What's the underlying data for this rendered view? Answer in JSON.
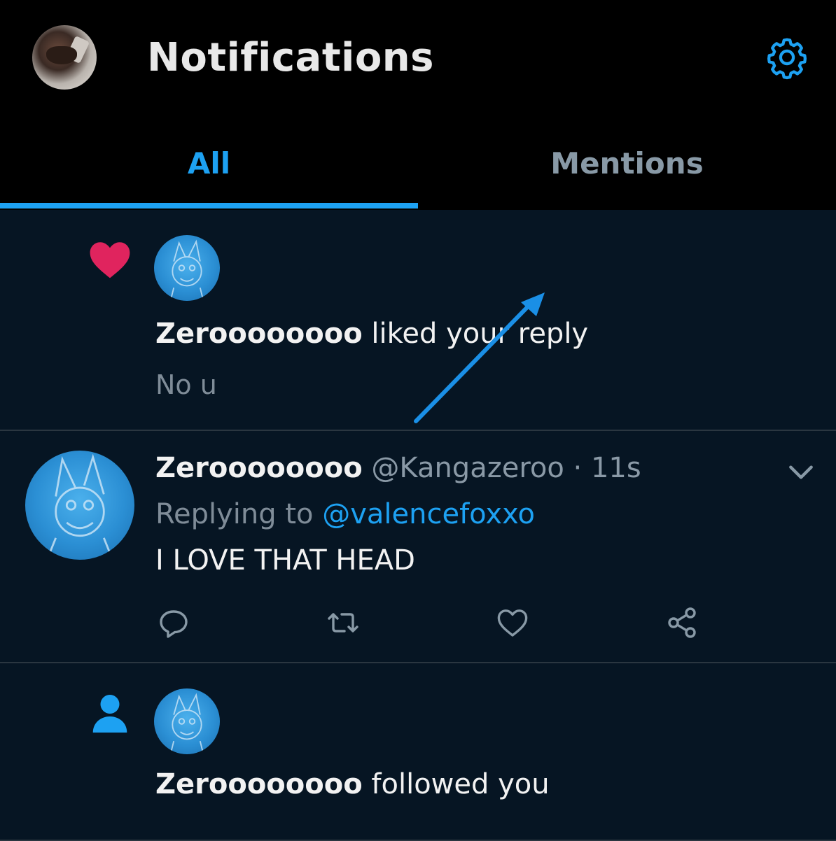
{
  "header": {
    "title": "Notifications",
    "settings_icon": "gear-icon",
    "accent": "#1da1f2"
  },
  "tabs": [
    {
      "label": "All",
      "active": true
    },
    {
      "label": "Mentions",
      "active": false
    }
  ],
  "notifications": [
    {
      "type": "like",
      "icon": "heart-icon",
      "icon_color": "#e0245e",
      "name": "Zeroooooooo",
      "action": " liked your reply",
      "excerpt": "No u"
    },
    {
      "type": "tweet",
      "name": "Zeroooooooo",
      "handle_time": " @Kangazeroo · 11s",
      "replying_prefix": "Replying to ",
      "replying_to": "@valencefoxxo",
      "text": "I LOVE THAT HEAD",
      "actions": [
        "reply-icon",
        "retweet-icon",
        "like-icon",
        "share-icon"
      ]
    },
    {
      "type": "follow",
      "icon": "person-icon",
      "icon_color": "#1da1f2",
      "name": "Zeroooooooo",
      "action": " followed you"
    }
  ],
  "annotation": {
    "icon": "arrow-annotation",
    "color": "#1a8fe6"
  }
}
